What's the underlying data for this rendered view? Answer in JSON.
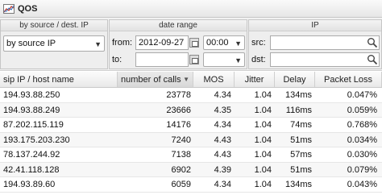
{
  "window": {
    "title": "QOS",
    "icon": "chart-icon"
  },
  "filters": {
    "grouping": {
      "header": "by source / dest. IP",
      "selected": "by source IP"
    },
    "date_range": {
      "header": "date range",
      "from_label": "from:",
      "from_date": "2012-09-27",
      "from_time": "00:00",
      "to_label": "to:",
      "to_date": "",
      "to_time": ""
    },
    "ip": {
      "header": "IP",
      "src_label": "src:",
      "src_value": "",
      "dst_label": "dst:",
      "dst_value": ""
    }
  },
  "table": {
    "columns": [
      "sip IP / host name",
      "number of calls",
      "MOS",
      "Jitter",
      "Delay",
      "Packet Loss"
    ],
    "sorted_column": "number of calls",
    "rows": [
      [
        "194.93.88.250",
        "23778",
        "4.34",
        "1.04",
        "134ms",
        "0.047%"
      ],
      [
        "194.93.88.249",
        "23666",
        "4.35",
        "1.04",
        "116ms",
        "0.059%"
      ],
      [
        "87.202.115.119",
        "14176",
        "4.34",
        "1.04",
        "74ms",
        "0.768%"
      ],
      [
        "193.175.203.230",
        "7240",
        "4.43",
        "1.04",
        "51ms",
        "0.034%"
      ],
      [
        "78.137.244.92",
        "7138",
        "4.43",
        "1.04",
        "57ms",
        "0.030%"
      ],
      [
        "42.41.118.128",
        "6902",
        "4.39",
        "1.04",
        "51ms",
        "0.079%"
      ],
      [
        "194.93.89.60",
        "6059",
        "4.34",
        "1.04",
        "134ms",
        "0.043%"
      ]
    ]
  }
}
